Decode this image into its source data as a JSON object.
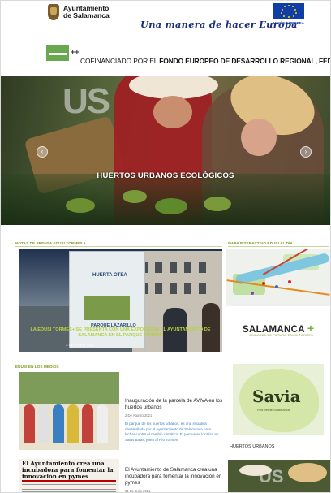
{
  "header": {
    "ayuntamiento_line1": "Ayuntamiento",
    "ayuntamiento_line2": "de Salamanca",
    "motto": "Una manera de hacer Europa",
    "eu_label": "UNIÓN EUROPEA",
    "feder_prefix": "COFINANCIADO POR EL ",
    "feder_bold": "FONDO EUROPEO DE DESARROLLO REGIONAL, FEDER",
    "feder_plus": "++",
    "colors": {
      "eu_blue": "#0f3fa6",
      "eu_star": "#ffd800",
      "motto": "#1c2e7a",
      "feder_green": "#6aa84f"
    }
  },
  "hero": {
    "overlay_text": "US",
    "title": "HUERTOS URBANOS ECOLÓGICOS",
    "prev_icon": "chevron-left-icon",
    "next_icon": "chevron-right-icon"
  },
  "news": {
    "section_title": "NOTAS DE PRENSA EDUSI TORMES +",
    "panel_title": "HUERTA OTEA",
    "panel_sign": "PARQUE LAZARILLO",
    "caption": "LA EDUSI TORMES+ SE PRESENTA CON UNA EXPOSICIÓN EL AYUNTAMIENTO DE SALAMANCA EN EL PARQUE TORMES",
    "date": "3 DE JUNIO 2021",
    "accent": "#b6d23a"
  },
  "sidebar": {
    "map_title": "MAPA INTERACTIVO EDUSI AL DÍA",
    "salamanca_plus": "SALAMANCA",
    "plus_sign": "+",
    "salamanca_sub": "CIUDADES DE FUTURO EDUSI TORMES",
    "savia_word": "Savia",
    "savia_sub": "Red Verde Salamanca",
    "huertos_title": "HUERTOS URBANOS",
    "huertos_overlay": "US",
    "accent": "#6fb43a"
  },
  "media": {
    "section_title": "EDUSI EN LOS MEDIOS",
    "items": [
      {
        "title": "Inauguración de la parcela de AVIVA en los huertos urbanos",
        "date": "2 De Agosto 2021",
        "excerpt": "El parque de los huertos urbanos, es una iniciativa desarrollada por el Ayuntamiento de Salamanca para luchar contra el cambio climático. El parque se localiza en Salas Bajas, junto al Río Tormes."
      },
      {
        "title": "El Ayuntamiento de Salamanca crea una incubadora para fomentar la innovación en pymes",
        "date": "31 De Julio 2021",
        "image_headline": "El Ayuntamiento crea una incubadora para fomentar la innovación en pymes"
      }
    ]
  }
}
